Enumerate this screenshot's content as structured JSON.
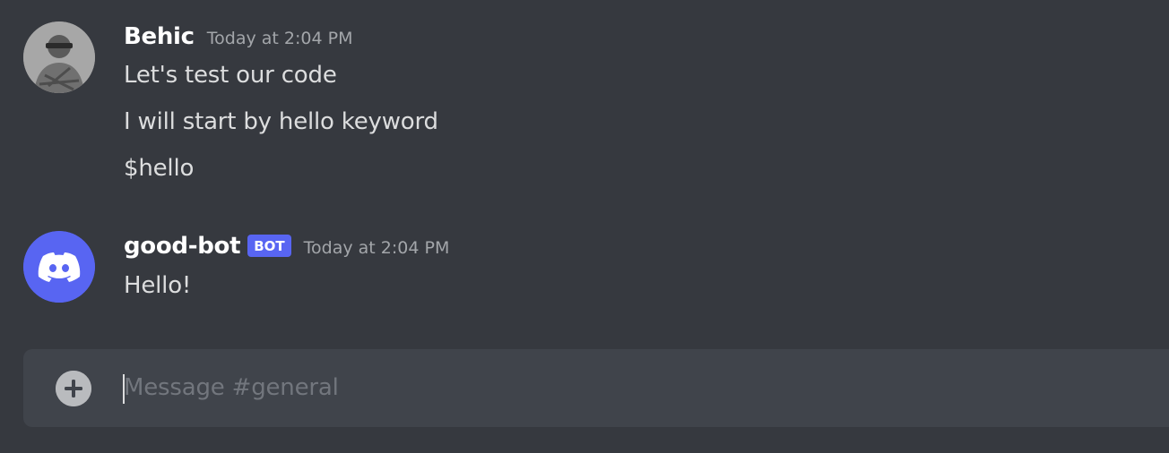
{
  "channel": {
    "composer_placeholder": "Message #general"
  },
  "messages": [
    {
      "author": "Behic",
      "avatar_icon": "user-photo",
      "timestamp": "Today at 2:04 PM",
      "lines": [
        "Let's test our code",
        "I will start by hello keyword",
        "$hello"
      ]
    },
    {
      "author": "good-bot",
      "avatar_icon": "discord-logo-icon",
      "badge": "BOT",
      "timestamp": "Today at 2:04 PM",
      "lines": [
        "Hello!"
      ]
    }
  ],
  "colors": {
    "background": "#36393f",
    "composer": "#40444b",
    "blurple": "#5865f2",
    "username": "#ffffff",
    "message_text": "#dcddde",
    "timestamp": "#a3a6aa"
  },
  "icons": {
    "add": "plus-circle-icon"
  }
}
